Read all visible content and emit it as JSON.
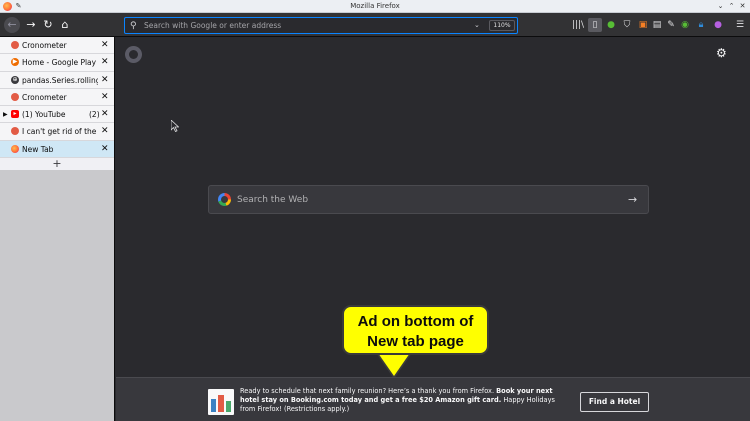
{
  "window": {
    "title": "Mozilla Firefox"
  },
  "toolbar": {
    "url_placeholder": "Search with Google or enter address",
    "zoom": "110%"
  },
  "sidebar": {
    "tabs": [
      {
        "label": "Cronometer",
        "favicon": "cronometer-icon",
        "count": ""
      },
      {
        "label": "Home - Google Play Music",
        "favicon": "play-music-icon",
        "count": ""
      },
      {
        "label": "pandas.Series.rolling",
        "favicon": "globe-icon",
        "count": ""
      },
      {
        "label": "Cronometer",
        "favicon": "cronometer-icon",
        "count": ""
      },
      {
        "label": "(1) YouTube",
        "favicon": "youtube-icon",
        "count": "(2)"
      },
      {
        "label": "I can't get rid of the sponsored",
        "favicon": "cronometer-icon",
        "count": ""
      },
      {
        "label": "New Tab",
        "favicon": "firefox-icon",
        "count": ""
      }
    ],
    "new_tab": "+"
  },
  "content": {
    "search_placeholder": "Search the Web"
  },
  "callout": {
    "line1": "Ad on bottom of",
    "line2": "New tab page"
  },
  "ad": {
    "text_plain_1": "Ready to schedule that next family reunion? Here’s a thank you from Firefox. ",
    "text_bold": "Book your next hotel stay on Booking.com today and get a free $20 Amazon gift card.",
    "text_plain_2": " Happy Holidays from Firefox! (Restrictions apply.)",
    "button": "Find a Hotel"
  },
  "colors": {
    "accent": "#0a84ff",
    "callout": "#ffff00",
    "active_tab": "#cfe7f5"
  }
}
